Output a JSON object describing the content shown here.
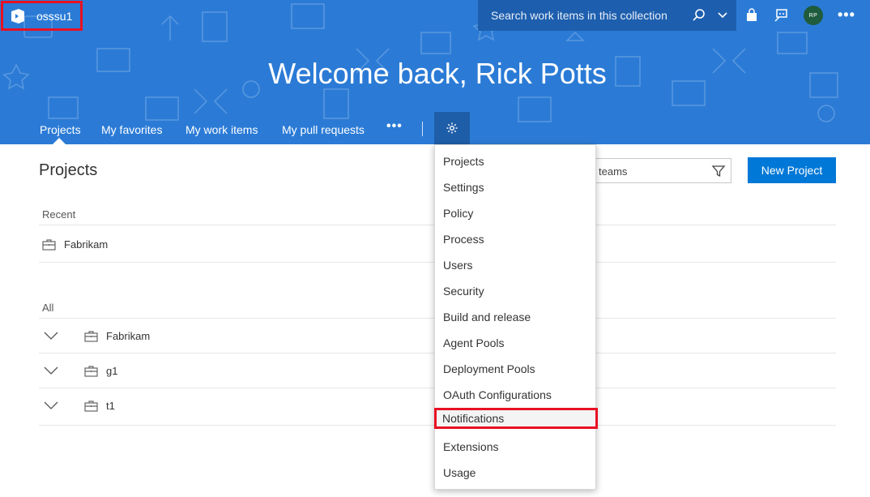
{
  "header": {
    "org_name": "osssu1",
    "search_placeholder": "Search work items in this collection",
    "avatar_initials": "RP",
    "welcome": "Welcome back, Rick Potts",
    "brand_color": "#2b7bd6"
  },
  "nav": {
    "items": [
      {
        "label": "Projects"
      },
      {
        "label": "My favorites"
      },
      {
        "label": "My work items"
      },
      {
        "label": "My pull requests"
      }
    ],
    "more": "•••"
  },
  "main": {
    "title": "Projects",
    "filter_text": "teams",
    "new_project": "New Project",
    "recent_label": "Recent",
    "recent": [
      {
        "name": "Fabrikam"
      }
    ],
    "all_label": "All",
    "all": [
      {
        "name": "Fabrikam"
      },
      {
        "name": "g1"
      },
      {
        "name": "t1"
      }
    ]
  },
  "dropdown": {
    "items": [
      {
        "label": "Projects"
      },
      {
        "label": "Settings"
      },
      {
        "label": "Policy"
      },
      {
        "label": "Process"
      },
      {
        "label": "Users"
      },
      {
        "label": "Security"
      },
      {
        "label": "Build and release"
      },
      {
        "label": "Agent Pools"
      },
      {
        "label": "Deployment Pools"
      },
      {
        "label": "OAuth Configurations"
      },
      {
        "label": "Notifications"
      },
      {
        "label": "Extensions"
      },
      {
        "label": "Usage"
      }
    ],
    "highlighted": "Notifications"
  }
}
